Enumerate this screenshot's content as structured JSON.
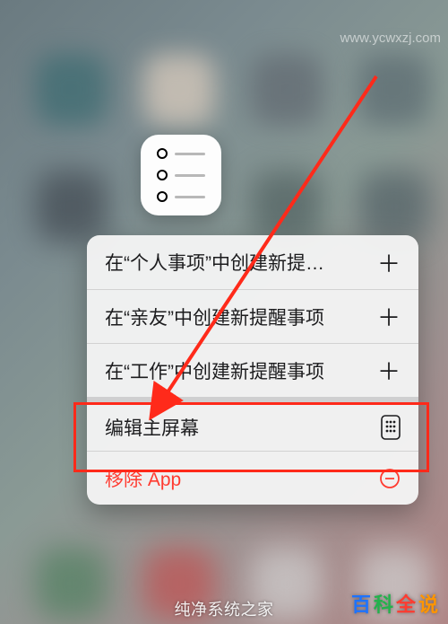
{
  "app_icon": {
    "name": "reminders-app-icon"
  },
  "menu": {
    "items": [
      {
        "label": "在“个人事项”中创建新提…",
        "icon": "plus",
        "destructive": false
      },
      {
        "label": "在“亲友”中创建新提醒事项",
        "icon": "plus",
        "destructive": false
      },
      {
        "label": "在“工作”中创建新提醒事项",
        "icon": "plus",
        "destructive": false
      },
      {
        "label": "编辑主屏幕",
        "icon": "apps",
        "destructive": false
      },
      {
        "label": "移除 App",
        "icon": "minus-circle",
        "destructive": true
      }
    ]
  },
  "annotation": {
    "highlighted_item_index": 3
  },
  "watermark": {
    "top": "www.ycwxzj.com",
    "bottom_brand": "百科全说",
    "bottom_url": "纯净系统之家"
  }
}
